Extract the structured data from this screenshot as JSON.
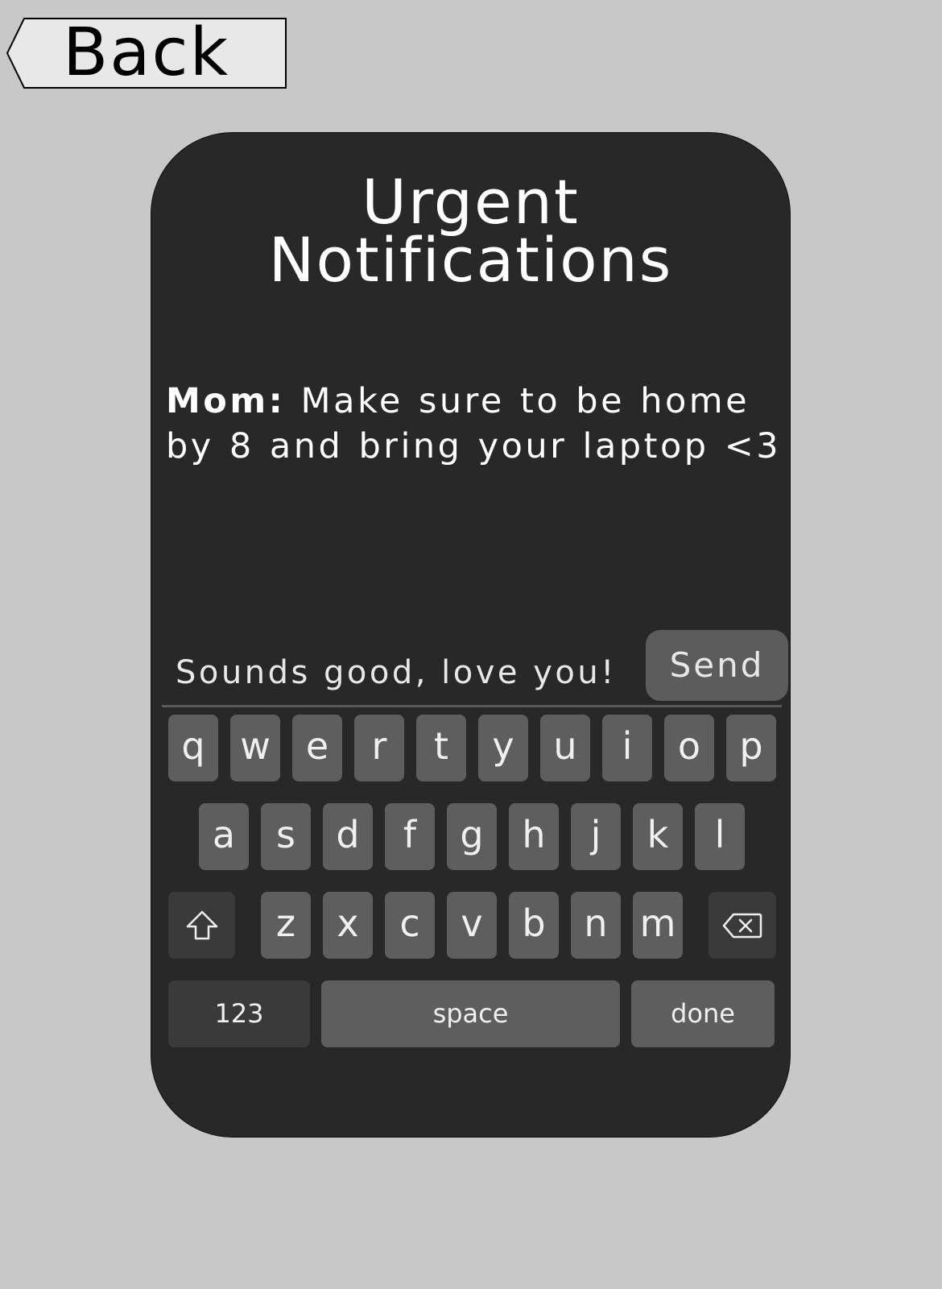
{
  "back_button": {
    "label": "Back"
  },
  "card": {
    "title_line1": "Urgent",
    "title_line2": "Notifications"
  },
  "message": {
    "sender": "Mom:",
    "text": " Make sure to be home by 8 and bring your laptop <3"
  },
  "reply": {
    "value": "Sounds good, love you!",
    "send_label": "Send"
  },
  "keyboard": {
    "row1": [
      "q",
      "w",
      "e",
      "r",
      "t",
      "y",
      "u",
      "i",
      "o",
      "p"
    ],
    "row2": [
      "a",
      "s",
      "d",
      "f",
      "g",
      "h",
      "j",
      "k",
      "l"
    ],
    "row3": [
      "z",
      "x",
      "c",
      "v",
      "b",
      "n",
      "m"
    ],
    "numbers_label": "123",
    "space_label": "space",
    "done_label": "done",
    "shift_icon": "shift-icon",
    "delete_icon": "backspace-icon"
  },
  "colors": {
    "background": "#c8c8c8",
    "card": "#282828",
    "key": "#5e5e5e",
    "key_dark": "#3a3a3a"
  }
}
